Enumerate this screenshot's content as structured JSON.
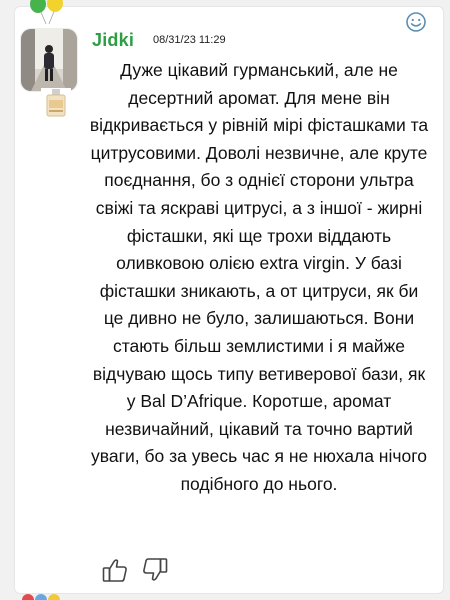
{
  "review": {
    "author": "Jidki",
    "date": "08/31/23 11:29",
    "text": "Дуже цікавий гурманський, але не десертний аромат. Для мене він відкривається у рівній мірі фісташками та цитрусовими. Доволі незвичне, але круте поєднання, бо з однієї сторони ультра свіжі та яскраві цитрусі, а з іншої - жирні фісташки, які ще трохи віддають оливковою олією extra virgin. У базі фісташки зникають, а от цитруси, як би це дивно не було, залишаються. Вони стають більш землистими і я майже відчуваю щось типу ветиверової бази, як у Bal D’Afrique. Коротше, аромат незвичайний, цікавий та точно вартий уваги, бо за увесь час я не нюхала нічого подібного до нього."
  },
  "icons": {
    "avatar": "user-photo",
    "balloons": "balloons-icon",
    "product": "perfume-bottle-icon",
    "smile": "smile-icon",
    "like": "thumbs-up-icon",
    "dislike": "thumbs-down-icon"
  },
  "colors": {
    "author_name": "#2e9e44",
    "accent_icon": "#5b8fb3",
    "text": "#111111"
  }
}
